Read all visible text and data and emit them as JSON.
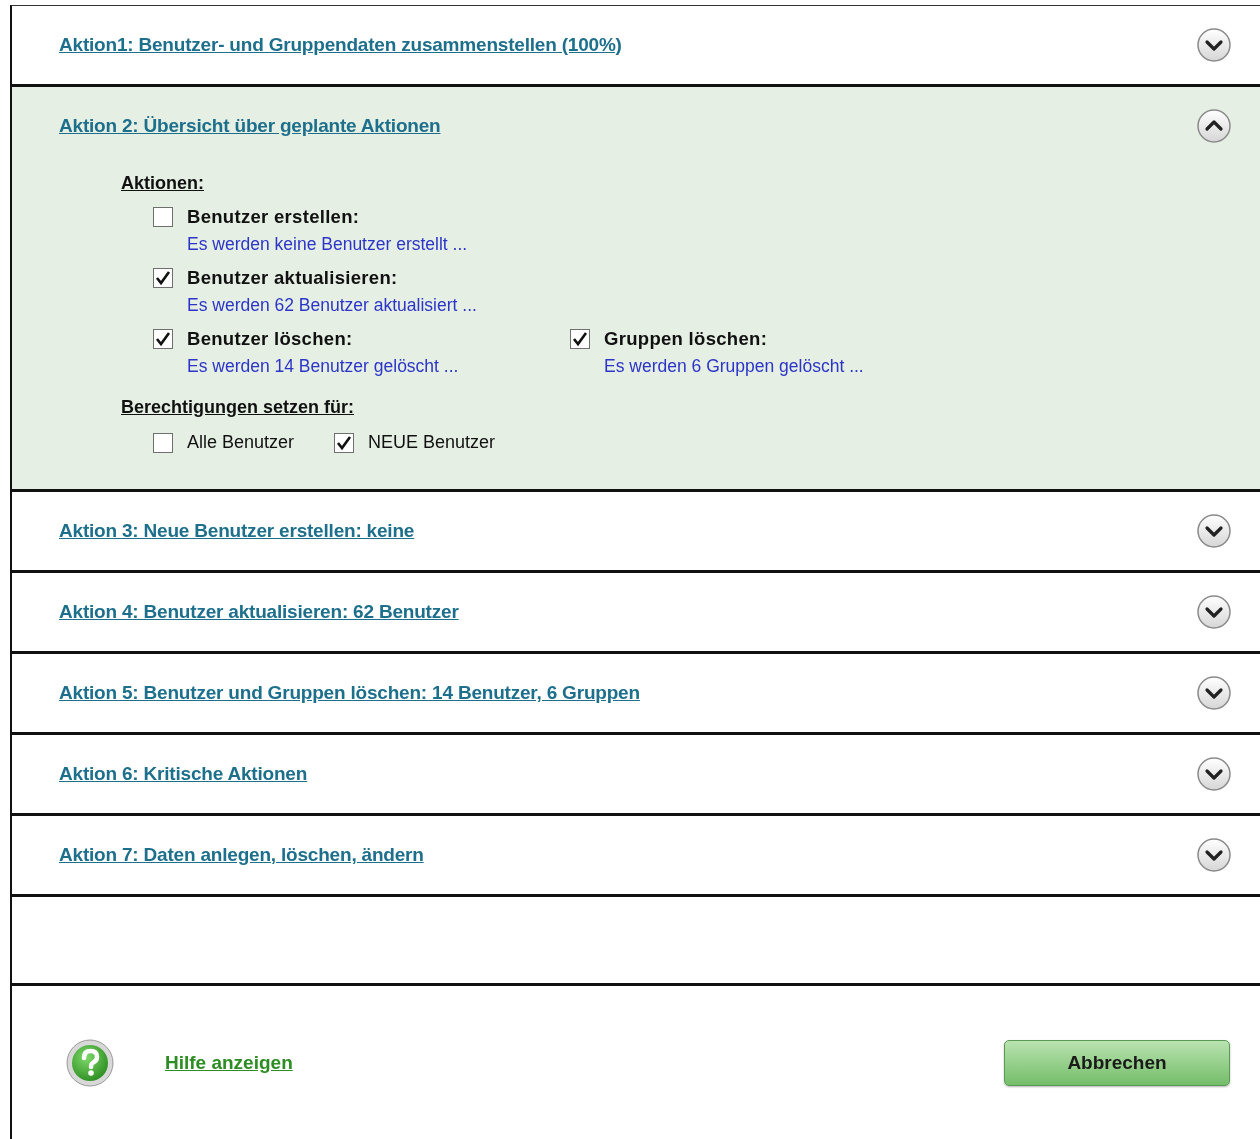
{
  "sections": [
    {
      "title": "Aktion1: Benutzer- und Gruppendaten zusammenstellen (100%)",
      "expanded": false
    },
    {
      "title": "Aktion 2: Übersicht über geplante Aktionen",
      "expanded": true,
      "content": {
        "actions_heading": "Aktionen:",
        "action_rows": [
          {
            "items": [
              {
                "label": "Benutzer erstellen:",
                "description": "Es werden keine Benutzer erstellt ...",
                "checked": false
              }
            ]
          },
          {
            "items": [
              {
                "label": "Benutzer aktualisieren:",
                "description": "Es werden 62 Benutzer aktualisiert ...",
                "checked": true
              }
            ]
          },
          {
            "items": [
              {
                "label": "Benutzer löschen:",
                "description": "Es werden 14 Benutzer gelöscht ...",
                "checked": true
              },
              {
                "label": "Gruppen löschen:",
                "description": "Es werden 6 Gruppen gelöscht ...",
                "checked": true
              }
            ]
          }
        ],
        "permissions_heading": "Berechtigungen setzen für:",
        "permissions": [
          {
            "label": "Alle Benutzer",
            "checked": false
          },
          {
            "label": "NEUE Benutzer",
            "checked": true
          }
        ]
      }
    },
    {
      "title": "Aktion 3: Neue Benutzer erstellen: keine",
      "expanded": false
    },
    {
      "title": "Aktion 4: Benutzer aktualisieren: 62 Benutzer",
      "expanded": false
    },
    {
      "title": "Aktion 5: Benutzer und Gruppen löschen: 14 Benutzer, 6 Gruppen",
      "expanded": false
    },
    {
      "title": "Aktion 6: Kritische Aktionen",
      "expanded": false
    },
    {
      "title": "Aktion 7: Daten anlegen, löschen, ändern",
      "expanded": false
    }
  ],
  "footer": {
    "help_link": "Hilfe anzeigen",
    "cancel_button": "Abbrechen"
  }
}
